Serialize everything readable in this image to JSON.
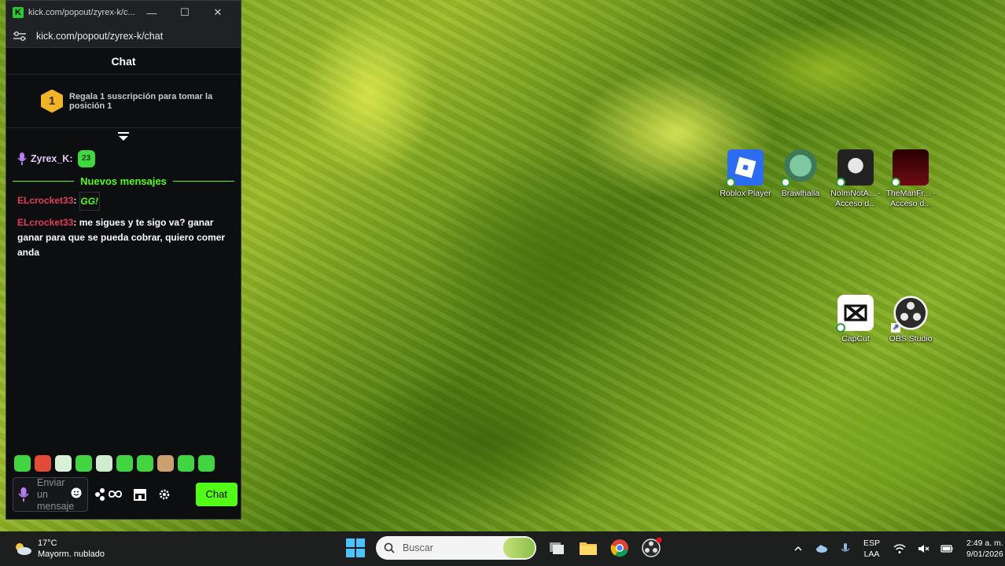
{
  "browser": {
    "window_title": "kick.com/popout/zyrex-k/c...",
    "url": "kick.com/popout/zyrex-k/chat"
  },
  "chat": {
    "header": "Chat",
    "leaderboard": {
      "rank": "1",
      "text": "Regala 1 suscripción para tomar la posición 1"
    },
    "pinned_message": {
      "username": "Zyrex_K:",
      "emote": "23"
    },
    "new_messages_label": "Nuevos mensajes",
    "messages": [
      {
        "username": "ELcrocket33",
        "separator": ":",
        "emote": "GG!",
        "text": ""
      },
      {
        "username": "ELcrocket33",
        "separator": ":",
        "text": " me sigues y te sigo va? ganar ganar para que se pueda cobrar, quiero comer anda"
      }
    ],
    "input_placeholder": "Enviar un mensaje",
    "send_button": "Chat"
  },
  "desktop_icons": [
    {
      "label": "Roblox Player",
      "icon": "roblox-icon"
    },
    {
      "label": "Brawlhalla",
      "icon": "brawlhalla-icon"
    },
    {
      "label": "NoImNotA... - Acceso d...",
      "icon": "shortcut-icon"
    },
    {
      "label": "TheManFr... - Acceso d...",
      "icon": "shortcut-icon"
    },
    {
      "label": "CapCut",
      "icon": "capcut-icon"
    },
    {
      "label": "OBS Studio",
      "icon": "obs-icon"
    }
  ],
  "taskbar": {
    "weather_temp": "17°C",
    "weather_desc": "Mayorm. nublado",
    "search_placeholder": "Buscar",
    "language_line1": "ESP",
    "language_line2": "LAA",
    "time": "2:49 a. m.",
    "date": "9/01/2026"
  },
  "colors": {
    "kick_green": "#53fc18",
    "username_red": "#e23c5c",
    "chat_bg": "#0d0e10"
  }
}
